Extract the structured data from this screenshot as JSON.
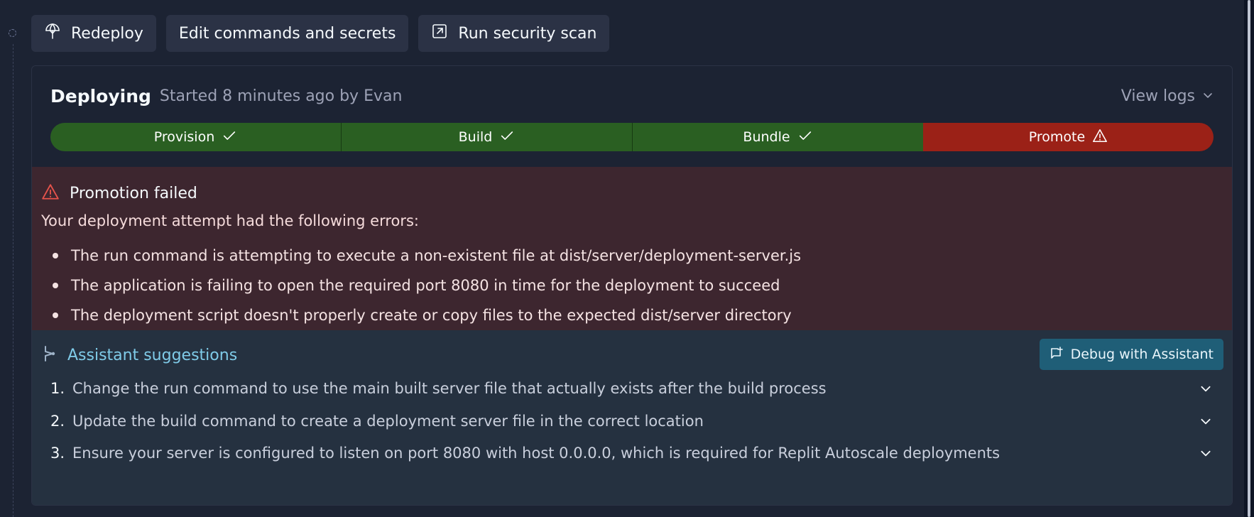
{
  "toolbar": {
    "redeploy_label": "Redeploy",
    "edit_label": "Edit commands and secrets",
    "scan_label": "Run security scan"
  },
  "deployment": {
    "status": "Deploying",
    "started": "Started 8 minutes ago by Evan",
    "view_logs_label": "View logs"
  },
  "pipeline": {
    "stages": [
      {
        "label": "Provision",
        "state": "success"
      },
      {
        "label": "Build",
        "state": "success"
      },
      {
        "label": "Bundle",
        "state": "success"
      },
      {
        "label": "Promote",
        "state": "failed"
      }
    ],
    "colors": {
      "success": "#2a5f22",
      "failed": "#9b2117"
    }
  },
  "error": {
    "title": "Promotion failed",
    "intro": "Your deployment attempt had the following errors:",
    "items": [
      "The run command is attempting to execute a non-existent file at dist/server/deployment-server.js",
      "The application is failing to open the required port 8080 in time for the deployment to succeed",
      "The deployment script doesn't properly create or copy files to the expected dist/server directory"
    ]
  },
  "assistant": {
    "title": "Assistant suggestions",
    "debug_label": "Debug with Assistant",
    "suggestions": [
      {
        "num": "1.",
        "text": "Change the run command to use the main built server file that actually exists after the build process"
      },
      {
        "num": "2.",
        "text": "Update the build command to create a deployment server file in the correct location"
      },
      {
        "num": "3.",
        "text": "Ensure your server is configured to listen on port 8080 with host 0.0.0.0, which is required for Replit Autoscale deployments"
      }
    ]
  }
}
